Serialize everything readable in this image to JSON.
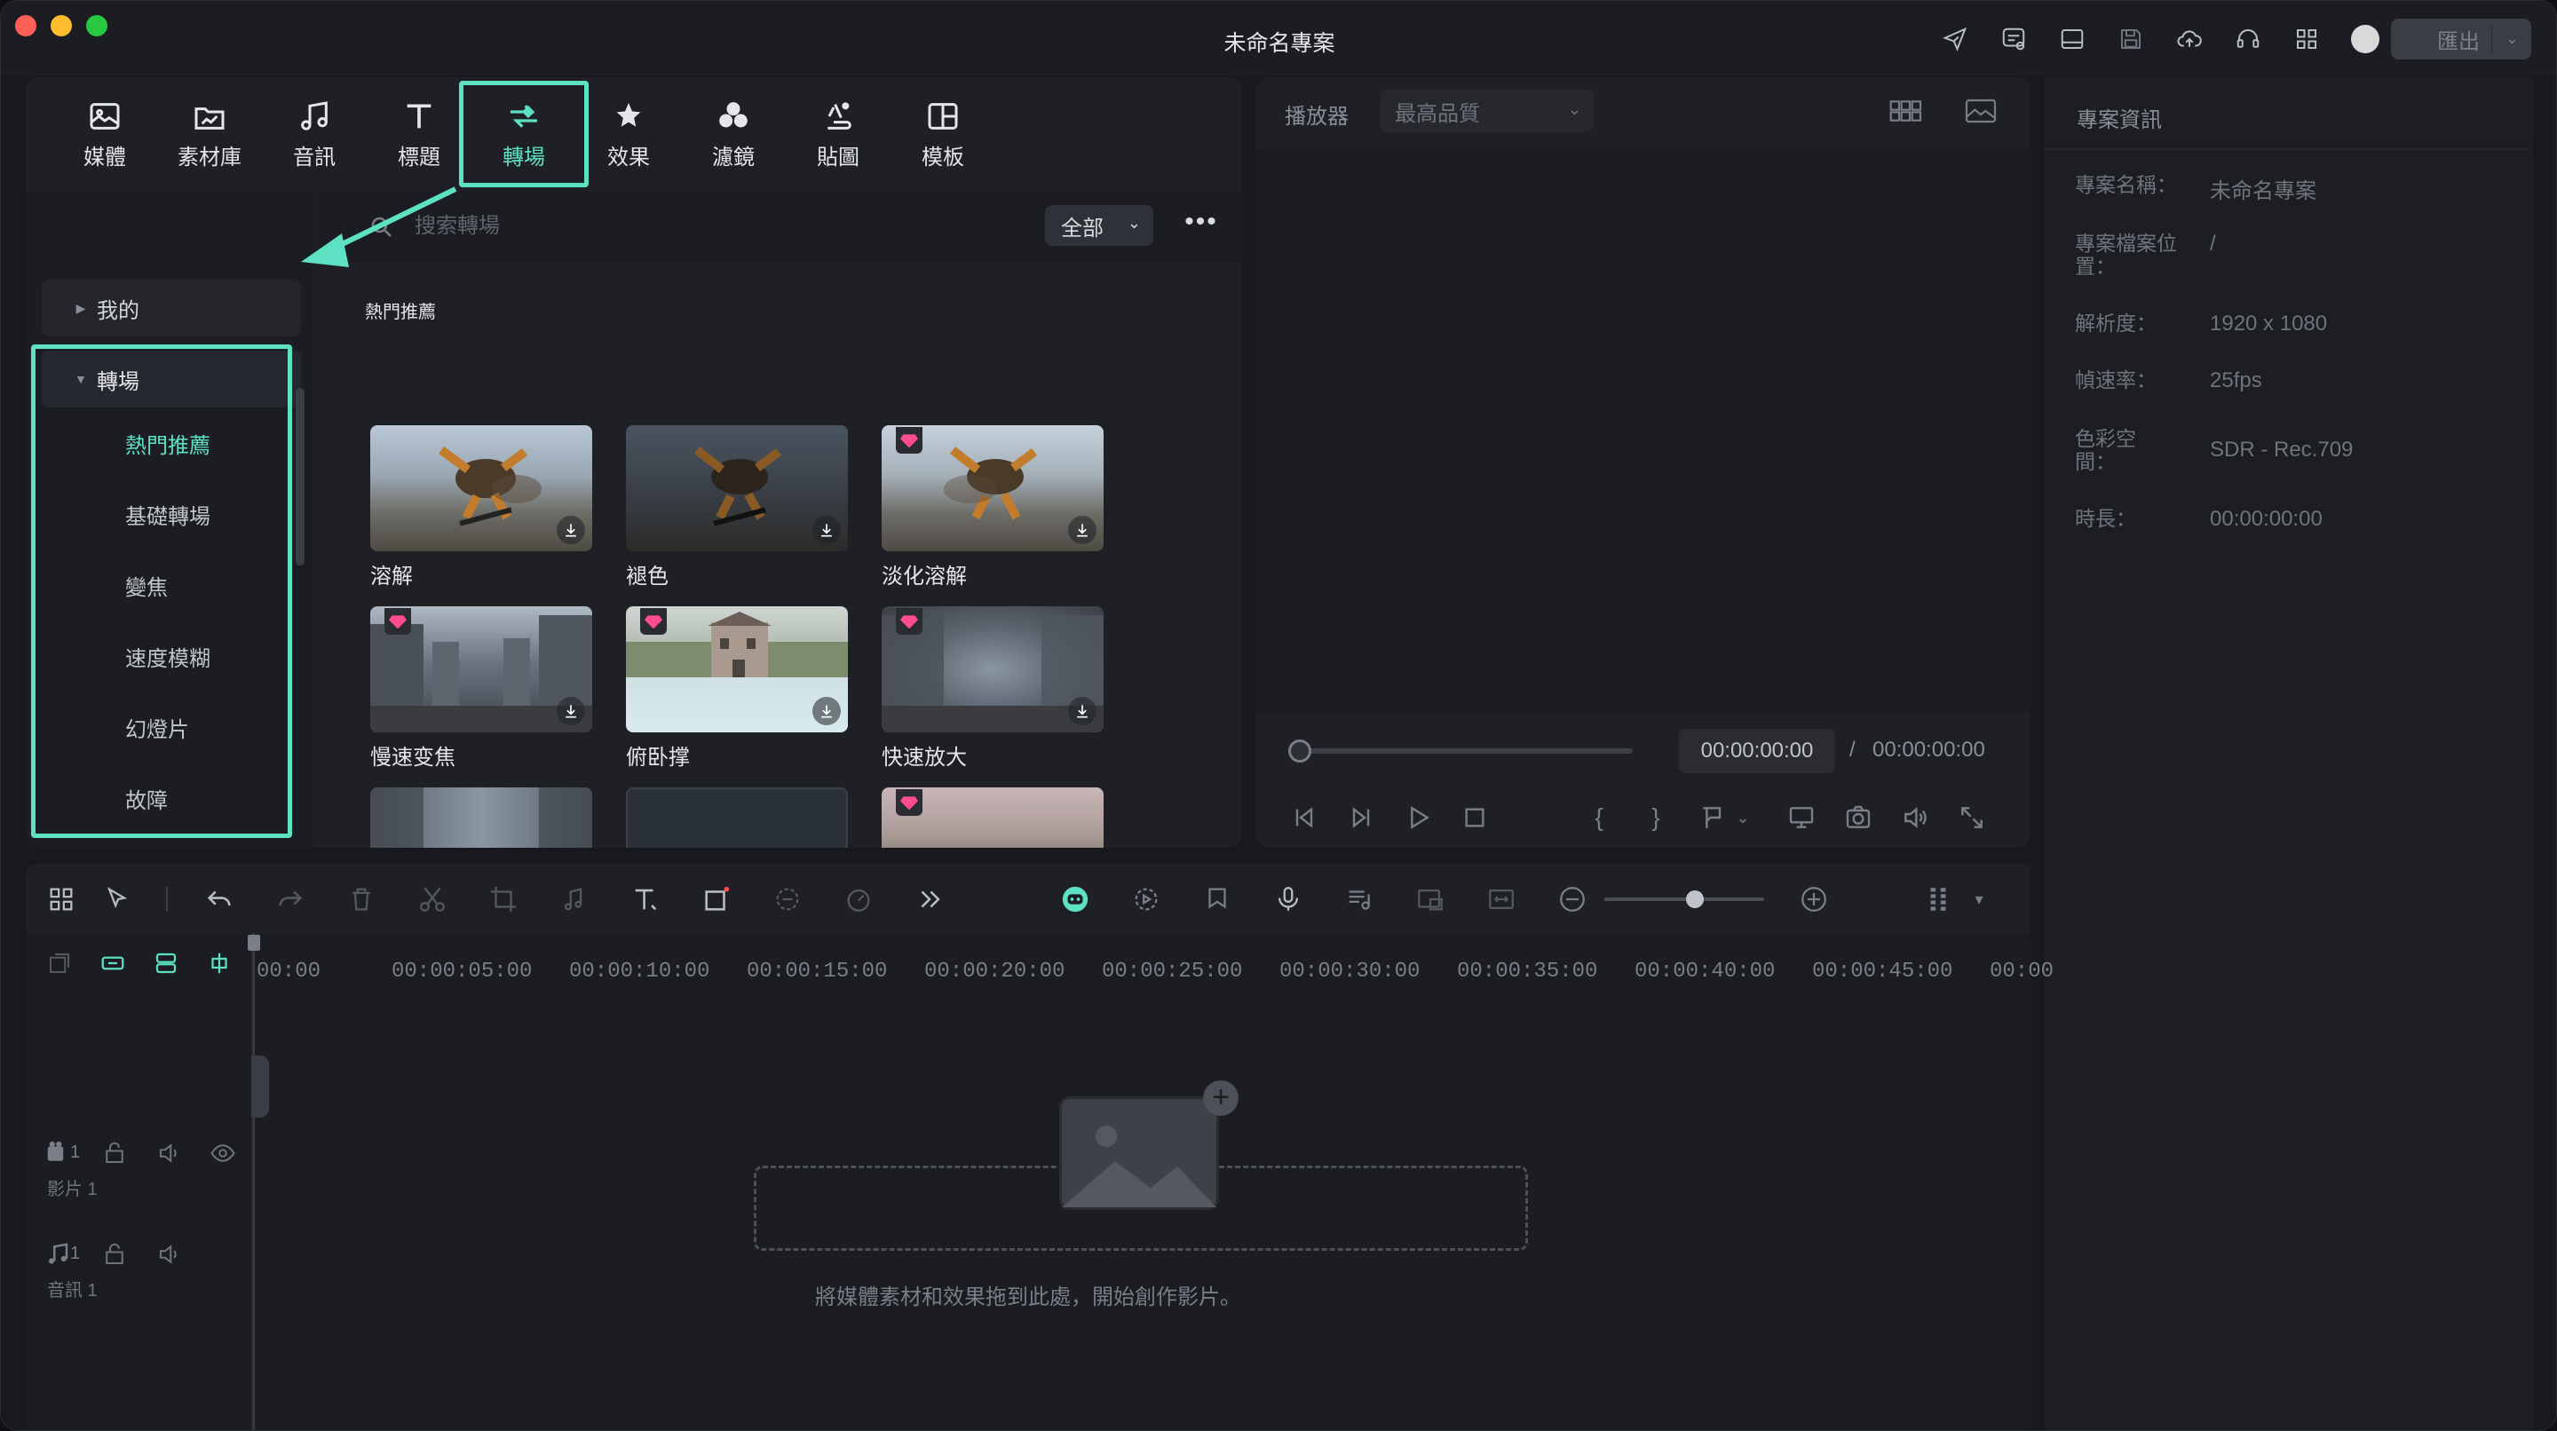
{
  "window": {
    "title": "未命名專案"
  },
  "titlebar": {
    "icons": [
      "send-icon",
      "feedback-icon",
      "layout-icon",
      "save-icon",
      "cloud-upload-icon",
      "headset-icon",
      "apps-grid-icon",
      "avatar"
    ],
    "export_label": "匯出"
  },
  "main_tabs": [
    {
      "label": "媒體",
      "icon": "media-icon"
    },
    {
      "label": "素材庫",
      "icon": "stock-icon"
    },
    {
      "label": "音訊",
      "icon": "music-note-icon"
    },
    {
      "label": "標題",
      "icon": "title-t-icon"
    },
    {
      "label": "轉場",
      "icon": "transition-icon",
      "active": true
    },
    {
      "label": "效果",
      "icon": "effects-star-icon"
    },
    {
      "label": "濾鏡",
      "icon": "filter-circles-icon"
    },
    {
      "label": "貼圖",
      "icon": "sticker-icon"
    },
    {
      "label": "模板",
      "icon": "template-icon"
    }
  ],
  "side_nav": {
    "mine": "我的",
    "section": "轉場",
    "items": [
      "熱門推薦",
      "基礎轉場",
      "變焦",
      "速度模糊",
      "幻燈片",
      "故障"
    ],
    "active": "熱門推薦"
  },
  "search": {
    "placeholder": "搜索轉場",
    "filter": "全部"
  },
  "grid": {
    "section_title": "熱門推薦",
    "items": [
      {
        "label": "溶解",
        "premium": false
      },
      {
        "label": "褪色",
        "premium": false
      },
      {
        "label": "淡化溶解",
        "premium": true
      },
      {
        "label": "慢速变焦",
        "premium": true
      },
      {
        "label": "俯卧撑",
        "premium": true
      },
      {
        "label": "快速放大",
        "premium": true
      },
      {
        "label": "",
        "premium": false
      },
      {
        "label": "",
        "premium": false
      },
      {
        "label": "",
        "premium": true
      }
    ]
  },
  "player": {
    "label": "播放器",
    "quality": "最高品質",
    "time_current": "00:00:00:00",
    "time_sep": "/",
    "time_total": "00:00:00:00"
  },
  "project_info": {
    "title": "專案資訊",
    "fields": [
      {
        "key": "專案名稱：",
        "value": "未命名專案"
      },
      {
        "key": "專案檔案位置：",
        "value": "/"
      },
      {
        "key": "解析度：",
        "value": "1920 x 1080"
      },
      {
        "key": "幀速率：",
        "value": "25fps"
      },
      {
        "key": "色彩空間：",
        "value": "SDR - Rec.709"
      },
      {
        "key": "時長：",
        "value": "00:00:00:00"
      }
    ]
  },
  "timeline": {
    "ruler": [
      "00:00",
      "00:00:05:00",
      "00:00:10:00",
      "00:00:15:00",
      "00:00:20:00",
      "00:00:25:00",
      "00:00:30:00",
      "00:00:35:00",
      "00:00:40:00",
      "00:00:45:00",
      "00:00"
    ],
    "tracks": [
      {
        "id": "1",
        "name": "影片 1",
        "type": "video"
      },
      {
        "id": "1",
        "name": "音訊 1",
        "type": "audio"
      }
    ],
    "drop_hint": "將媒體素材和效果拖到此處，開始創作影片。"
  },
  "colors": {
    "accent": "#5ee1c2",
    "premium_gem": "#ff4d8d"
  }
}
